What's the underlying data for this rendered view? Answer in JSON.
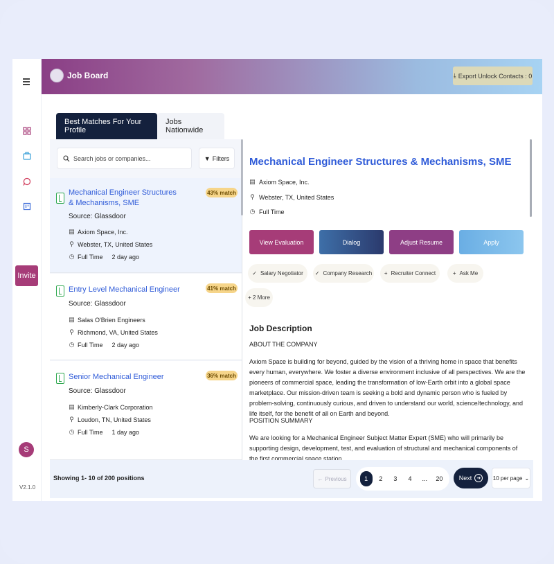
{
  "app": {
    "title": "Job Board",
    "version": "V2.1.0",
    "user_initial": "S",
    "invite_label": "Invite"
  },
  "header": {
    "export_label": "Export Unlock Contacts : 0"
  },
  "tabs": [
    {
      "label": "Best Matches For Your Profile",
      "active": true
    },
    {
      "label": "Jobs Nationwide",
      "active": false
    }
  ],
  "search": {
    "placeholder": "Search jobs or companies...",
    "filters_label": "Filters"
  },
  "jobs": [
    {
      "title": "Mechanical Engineer Structures & Mechanisms, SME",
      "match": "43% match",
      "source": "Source: Glassdoor",
      "company": "Axiom Space, Inc.",
      "location": "Webster, TX, United States",
      "type": "Full Time",
      "posted": "2 day ago"
    },
    {
      "title": "Entry Level Mechanical Engineer",
      "match": "41% match",
      "source": "Source: Glassdoor",
      "company": "Salas O'Brien Engineers",
      "location": "Richmond, VA, United States",
      "type": "Full Time",
      "posted": "2 day ago"
    },
    {
      "title": "Senior Mechanical Engineer",
      "match": "36% match",
      "source": "Source: Glassdoor",
      "company": "Kimberly-Clark Corporation",
      "location": "Loudon, TN, United States",
      "type": "Full Time",
      "posted": "1 day ago"
    }
  ],
  "detail": {
    "title": "Mechanical Engineer Structures & Mechanisms, SME",
    "company": "Axiom Space, Inc.",
    "location": "Webster, TX, United States",
    "type": "Full Time",
    "actions": [
      "View Evaluation",
      "Dialog",
      "Adjust Resume",
      "Apply"
    ],
    "chips": [
      "Salary Negotiator",
      "Company Research",
      "Recruiter Connect",
      "Ask Me",
      "+ 2 More"
    ],
    "jd_heading": "Job Description",
    "about_heading": "ABOUT THE COMPANY",
    "about_text": "Axiom Space is building for beyond, guided by the vision of a thriving home in space that benefits every human, everywhere. We foster a diverse environment inclusive of all perspectives. We are the pioneers of commercial space, leading the transformation of low-Earth orbit into a global space marketplace. Our mission-driven team is seeking a bold and dynamic person who is fueled by problem-solving, continuously curious, and driven to understand our world, science/technology, and life itself, for the benefit of all on Earth and beyond.",
    "position_heading": "POSITION SUMMARY",
    "position_text": "We are looking for a Mechanical Engineer Subject Matter Expert (SME) who will primarily be supporting design, development, test, and evaluation of structural and mechanical components of the first commercial space station."
  },
  "pagination": {
    "showing": "Showing 1- 10 of 200 positions",
    "prev_label": "Previous",
    "pages": [
      "1",
      "2",
      "3",
      "4",
      "...",
      "20"
    ],
    "next_label": "Next",
    "per_page": "10 per page"
  }
}
